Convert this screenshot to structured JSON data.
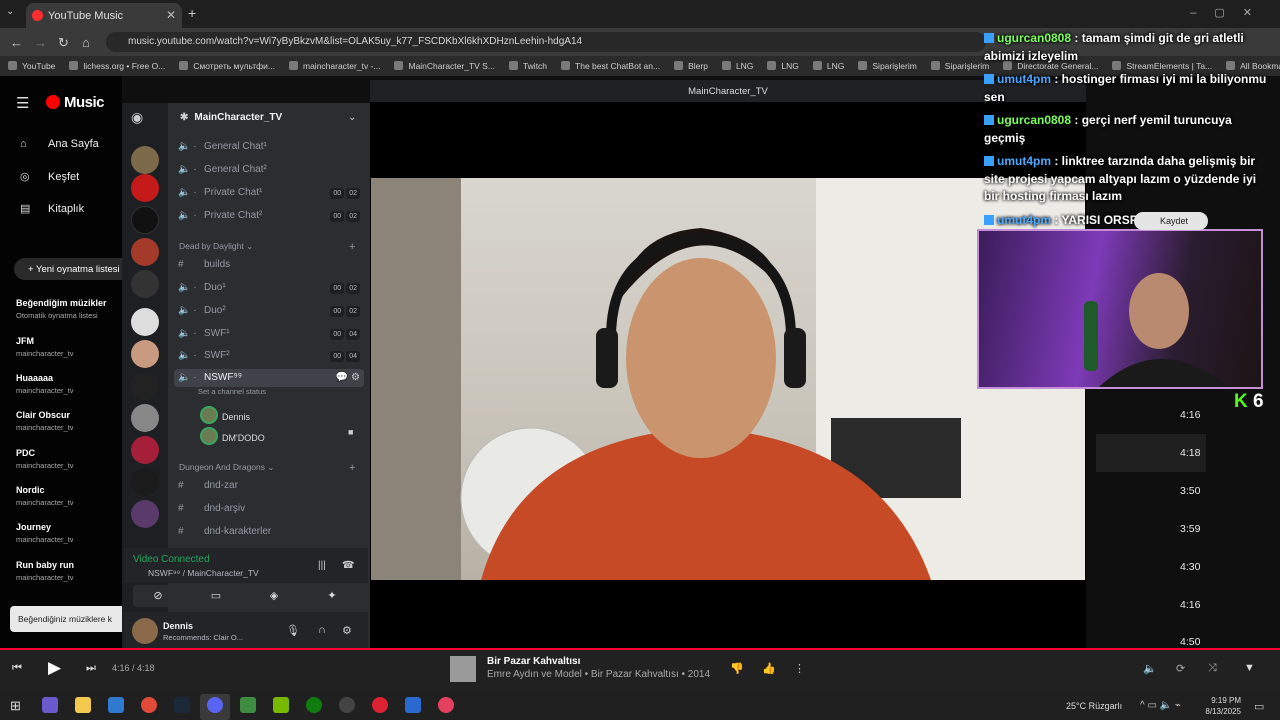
{
  "browser": {
    "tab_title": "YouTube Music",
    "url": "music.youtube.com/watch?v=Wi7yByBkzvM&list=OLAK5uy_k77_FSCDKbXl6khXDHznLeehin-hdgA14",
    "bookmarks": [
      "YouTube",
      "lichess.org • Free O...",
      "Смотреть мультфи...",
      "maincharacter_tv -...",
      "MainCharacter_TV S...",
      "Twitch",
      "The best ChatBot an...",
      "Blerp",
      "LNG",
      "LNG",
      "LNG",
      "Siparişlerim",
      "Siparişlerim",
      "Directorate General...",
      "StreamElements | Ta...",
      "All Bookmarks"
    ]
  },
  "ytmusic": {
    "logo": "Music",
    "nav": [
      "Ana Sayfa",
      "Keşfet",
      "Kitaplık"
    ],
    "new_playlist": "Yeni oynatma listesi",
    "playlists": [
      {
        "title": "Beğendiğim müzikler",
        "sub": "Otomatik oynatma listesi"
      },
      {
        "title": "JFM",
        "sub": "maincharacter_tv"
      },
      {
        "title": "Huaaaaa",
        "sub": "maincharacter_tv"
      },
      {
        "title": "Clair Obscur",
        "sub": "maincharacter_tv"
      },
      {
        "title": "PDC",
        "sub": "maincharacter_tv"
      },
      {
        "title": "Nordic",
        "sub": "maincharacter_tv"
      },
      {
        "title": "Journey",
        "sub": "maincharacter_tv"
      },
      {
        "title": "Run baby run",
        "sub": "maincharacter_tv"
      }
    ],
    "tooltip": "Beğendiğiniz müziklere k",
    "durations": [
      "4:16",
      "4:18",
      "3:50",
      "3:59",
      "4:30",
      "4:16",
      "4:50"
    ],
    "save_label": "Kaydet"
  },
  "discord": {
    "server": "MainCharacter_TV",
    "channels": [
      {
        "name": "General Chat¹",
        "tags": []
      },
      {
        "name": "General Chat²",
        "tags": []
      },
      {
        "name": "Private Chat¹",
        "tags": [
          "00",
          "02"
        ]
      },
      {
        "name": "Private Chat²",
        "tags": [
          "00",
          "02"
        ]
      }
    ],
    "cat1": "Dead by Daylight",
    "channels2": [
      {
        "name": "builds",
        "tags": []
      },
      {
        "name": "Duo¹",
        "tags": [
          "00",
          "02"
        ]
      },
      {
        "name": "Duo²",
        "tags": [
          "00",
          "02"
        ]
      },
      {
        "name": "SWF¹",
        "tags": [
          "00",
          "04"
        ]
      },
      {
        "name": "SWF²",
        "tags": [
          "00",
          "04"
        ]
      }
    ],
    "active_channel": "NSWF⁹⁹",
    "channel_status": "Set a channel status",
    "voice_users": [
      "Dennis",
      "DM'DODO"
    ],
    "cat2": "Dungeon And Dragons",
    "channels3": [
      "dnd-zar",
      "dnd-arşiv",
      "dnd-karakterler"
    ],
    "vc_status": "Video Connected",
    "vc_channel": "NSWF⁹⁹ / MainCharacter_TV",
    "user_name": "Dennis",
    "user_status": "Recommends: Clair O..."
  },
  "video": {
    "window_title": "MainCharacter_TV"
  },
  "chat": [
    {
      "user": "ugurcan0808",
      "color": "#7cff5a",
      "text": "tamam şimdi git de gri atletli abimizi izleyelim"
    },
    {
      "user": "umut4pm",
      "color": "#4aa8ff",
      "text": "hostinger firması iyi mi la biliyonmu sen"
    },
    {
      "user": "ugurcan0808",
      "color": "#7cff5a",
      "text": "gerçi nerf yemil turuncuya geçmiş"
    },
    {
      "user": "umut4pm",
      "color": "#4aa8ff",
      "text": "linktree tarzında daha gelişmiş bir site projesi yapcam altyapı lazım o yüzdende iyi bir hosting firması lazım"
    },
    {
      "user": "umut4pm",
      "color": "#4aa8ff",
      "text": "YARISI ORSPUCOCU"
    }
  ],
  "kick_count": "6",
  "player": {
    "time": "4:16 / 4:18",
    "title": "Bir Pazar Kahvaltısı",
    "subtitle": "Emre Aydın ve Model • Bir Pazar Kahvaltısı • 2014"
  },
  "taskbar": {
    "weather": "25°C Rüzgarlı",
    "time": "9:19 PM",
    "date": "8/13/2025"
  }
}
